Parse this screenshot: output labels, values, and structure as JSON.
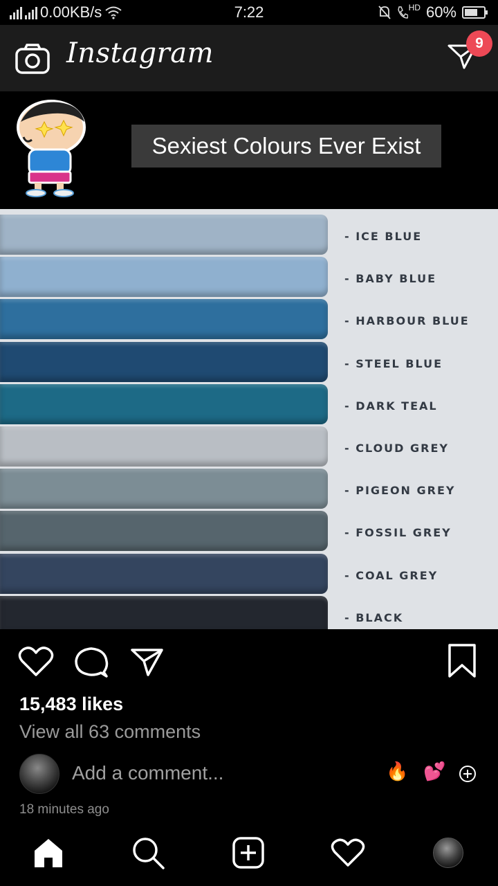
{
  "status": {
    "network_speed": "0.00KB/s",
    "time": "7:22",
    "hd_label": "HD",
    "battery": "60%"
  },
  "header": {
    "app_name": "Instagram",
    "dm_badge_count": "9"
  },
  "post": {
    "overlay_caption": "Sexiest Colours Ever Exist",
    "swatches": [
      {
        "label": "- ICE BLUE",
        "color": "#9fb3c6"
      },
      {
        "label": "- BABY BLUE",
        "color": "#8fb0cf"
      },
      {
        "label": "- HARBOUR BLUE",
        "color": "#2e6f9e"
      },
      {
        "label": "- STEEL BLUE",
        "color": "#1f4a72"
      },
      {
        "label": "- DARK TEAL",
        "color": "#1d6a86"
      },
      {
        "label": "- CLOUD GREY",
        "color": "#b9bec4"
      },
      {
        "label": "- PIGEON GREY",
        "color": "#7c8d95"
      },
      {
        "label": "- FOSSIL GREY",
        "color": "#56656d"
      },
      {
        "label": "- COAL GREY",
        "color": "#34455f"
      },
      {
        "label": "- BLACK",
        "color": "#23272f"
      }
    ],
    "likes": "15,483 likes",
    "view_comments": "View all 63 comments",
    "add_comment_placeholder": "Add a comment...",
    "quick_emojis": [
      "🔥",
      "💕"
    ],
    "timestamp": "18 minutes ago"
  },
  "nav": {
    "items": [
      "home-icon",
      "search-icon",
      "new-post-icon",
      "activity-icon",
      "profile-avatar"
    ]
  }
}
